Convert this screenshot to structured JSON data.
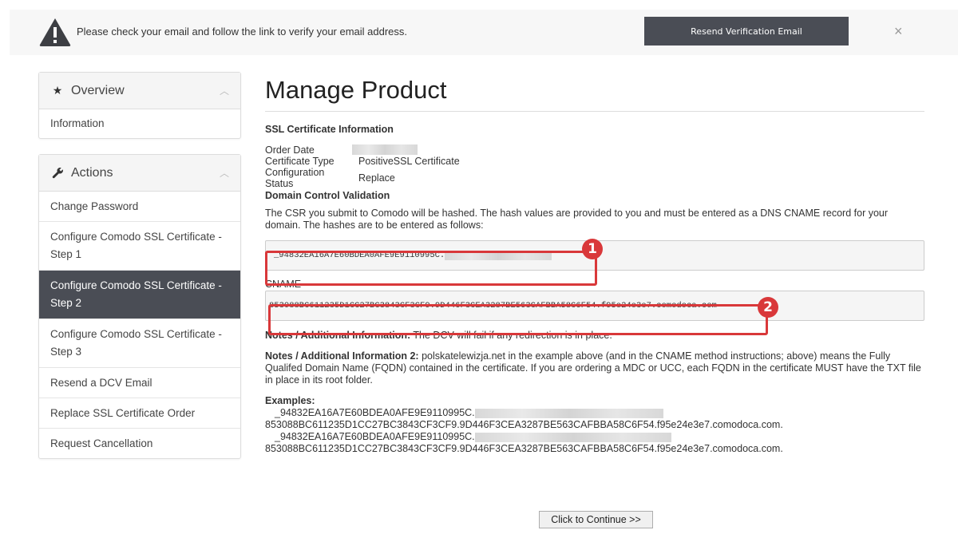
{
  "alert": {
    "message": "Please check your email and follow the link to verify your email address.",
    "resend_label": "Resend Verification Email",
    "close_glyph": "×",
    "icon": "warning-icon"
  },
  "sidebar": {
    "overview": {
      "title": "Overview",
      "icon": "star-icon",
      "items": [
        {
          "label": "Information"
        }
      ]
    },
    "actions": {
      "title": "Actions",
      "icon": "wrench-icon",
      "items": [
        {
          "label": "Change Password",
          "active": false
        },
        {
          "label": "Configure Comodo SSL Certificate - Step 1",
          "active": false
        },
        {
          "label": "Configure Comodo SSL Certificate - Step 2",
          "active": true
        },
        {
          "label": "Configure Comodo SSL Certificate - Step 3",
          "active": false
        },
        {
          "label": "Resend a DCV Email",
          "active": false
        },
        {
          "label": "Replace SSL Certificate Order",
          "active": false
        },
        {
          "label": "Request Cancellation",
          "active": false
        }
      ]
    }
  },
  "main": {
    "title": "Manage Product",
    "ssl_info_title": "SSL Certificate Information",
    "order_date_label": "Order Date",
    "cert_type_label": "Certificate Type",
    "cert_type_value": "PositiveSSL Certificate",
    "config_status_label": "Configuration Status",
    "config_status_value": "Replace",
    "dcv_title": "Domain Control Validation",
    "dcv_text": "The CSR you submit to Comodo will be hashed. The hash values are provided to you and must be entered as a DNS CNAME record for your domain. The hashes are to be entered as follows:",
    "hash_value": "_94832EA16A7E60BDEA0AFE9E9110995C.",
    "cname_label": "CNAME",
    "cname_value": "853088BC611235D1CC27BC3843CF3CF9.9D446F3CEA3287BE563CAFBBA58C6F54.f95e24e3e7.comodoca.com",
    "notes1_label": "Notes / Additional Information:",
    "notes1_text": " The DCV will fail if any redirection is in place.",
    "notes2_label": "Notes / Additional Information 2:",
    "notes2_text": " polskatelewizja.net in the example above (and in the CNAME method instructions; above) means the Fully Qualifed Domain Name (FQDN) contained in the certificate. If you are ordering a MDC or UCC, each FQDN in the certificate MUST have the TXT file in place in its root folder.",
    "examples_label": "Examples:",
    "example1_hash": "_94832EA16A7E60BDEA0AFE9E9110995C.",
    "example1_cname": "853088BC611235D1CC27BC3843CF3CF9.9D446F3CEA3287BE563CAFBBA58C6F54.f95e24e3e7.comodoca.com.",
    "example2_hash": "_94832EA16A7E60BDEA0AFE9E9110995C.",
    "example2_cname": "853088BC611235D1CC27BC3843CF3CF9.9D446F3CEA3287BE563CAFBBA58C6F54.f95e24e3e7.comodoca.com.",
    "continue_label": "Click to Continue >>"
  },
  "annotations": {
    "badge1": "1",
    "badge2": "2",
    "highlight_color": "#d9383a"
  },
  "colors": {
    "active_bg": "#4a4d55",
    "button_bg": "#4a4d55"
  }
}
